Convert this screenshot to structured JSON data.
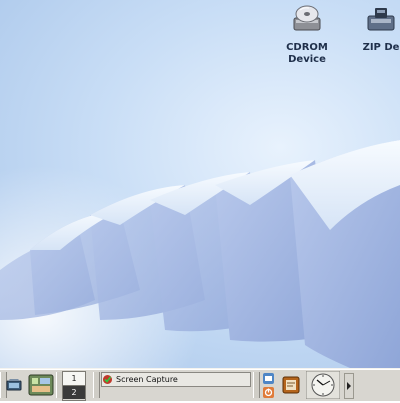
{
  "desktop": {
    "icons": [
      {
        "name": "cdrom-device",
        "label": "CDROM\nDevice"
      },
      {
        "name": "zip-device",
        "label": "ZIP De"
      }
    ]
  },
  "taskbar": {
    "pager": {
      "workspace_1": "1",
      "workspace_2": "2"
    },
    "tasklist": {
      "window_title": "Screen Capture"
    }
  }
}
